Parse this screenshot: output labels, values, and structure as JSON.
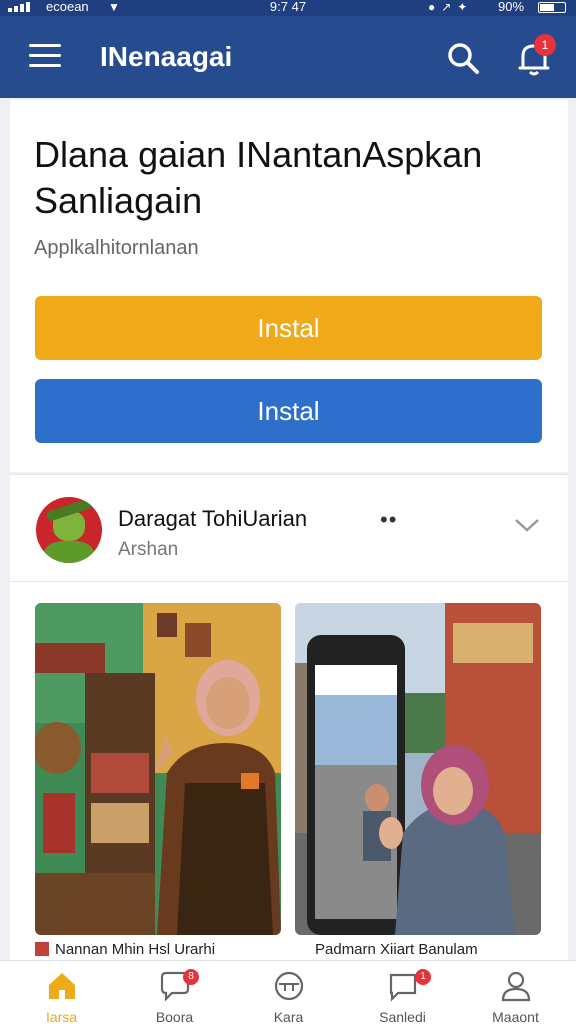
{
  "status_bar": {
    "carrier": "ecoean",
    "time": "9:7 47",
    "battery": "90%"
  },
  "app_bar": {
    "title": "INenaagai",
    "notification_badge": "1",
    "icons": [
      "menu-icon",
      "search-icon",
      "notification-bell-icon"
    ]
  },
  "promo": {
    "heading": "Dlana gaian INantanAspkan Sanliagain",
    "subtitle": "Applkalhitornlanan",
    "primary_button": "Instal",
    "secondary_button": "Instal"
  },
  "post": {
    "author": "Daragat TohiUarian",
    "meta": "Arshan",
    "more": "••",
    "photos": [
      {
        "caption": "Nannan Mhin Hsl Urarhi"
      },
      {
        "caption": "Padmarn Xiiart Banulam"
      }
    ]
  },
  "bottom_nav": {
    "items": [
      {
        "label": "Iarsa",
        "icon": "home-icon",
        "active": true
      },
      {
        "label": "Boora",
        "icon": "chat-icon",
        "badge": "8"
      },
      {
        "label": "Kara",
        "icon": "compass-icon"
      },
      {
        "label": "Sanledi",
        "icon": "message-icon",
        "badge": "1"
      },
      {
        "label": "Maaont",
        "icon": "profile-icon"
      }
    ]
  },
  "colors": {
    "app_bar": "#274b8f",
    "primary_button": "#f0a918",
    "secondary_button": "#2f6fcc",
    "badge": "#e8323c"
  }
}
